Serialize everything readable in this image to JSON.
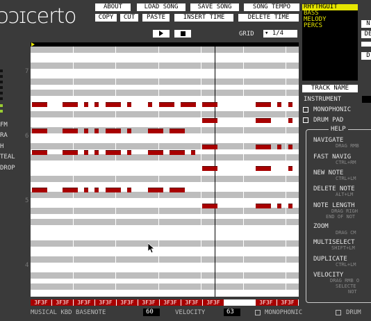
{
  "app": {
    "logo": "ɔɔɪcerto"
  },
  "toolbar": {
    "row1": [
      "ABOUT",
      "LOAD SONG",
      "SAVE SONG",
      "SONG TEMPO"
    ],
    "row2": [
      "COPY",
      "CUT",
      "PASTE",
      "INSERT TIME",
      "DELETE TIME"
    ]
  },
  "transport": {
    "play_icon": "play-icon",
    "stop_icon": "stop-icon"
  },
  "grid": {
    "label": "GRID",
    "value": "1/4"
  },
  "tracks": [
    {
      "name": "RHYTHGUIT",
      "selected": true
    },
    {
      "name": "BASS",
      "selected": false
    },
    {
      "name": "MELODY",
      "selected": false
    },
    {
      "name": "PERCS",
      "selected": false
    }
  ],
  "right_edge": {
    "n": "N",
    "de": "DE",
    "d": "D"
  },
  "track_panel": {
    "track_name_btn": "TRACK NAME",
    "instrument_label": "INSTRUMENT",
    "monophonic_label": "MONOPHONIC",
    "drum_pad_label": "DRUM PAD"
  },
  "left_labels": [
    "FM",
    "RA",
    "H",
    "TEAL",
    "DROP"
  ],
  "octave_labels": [
    "7",
    "6",
    "5",
    "4"
  ],
  "help": {
    "title": "HELP",
    "items": [
      {
        "title": "NAVIGATE",
        "sub": "DRAG RMB"
      },
      {
        "title": "FAST NAVIG",
        "sub": "CTRL+RM"
      },
      {
        "title": "NEW NOTE",
        "sub": "CTRL+LM"
      },
      {
        "title": "DELETE NOTE",
        "sub": "ALT+LM"
      },
      {
        "title": "NOTE LENGTH",
        "sub": "DRAG RIGH",
        "sub2": "END OF NOT"
      },
      {
        "title": "ZOOM",
        "sub": "DRAG CM"
      },
      {
        "title": "MULTISELECT",
        "sub": "SHIFT+LM"
      },
      {
        "title": "DUPLICATE",
        "sub": "CTRL+LM"
      },
      {
        "title": "VELOCITY",
        "sub": "DRAG RMB O",
        "sub2": "SELECTE",
        "sub3": "NOT"
      }
    ]
  },
  "ruler": [
    "3F3F",
    "3F3F",
    "3F3F",
    "3F3F",
    "3F3F",
    "3F3F",
    "3F3F",
    "3F3F",
    "3F3F",
    "3F3F",
    "3F3F",
    "3F3F"
  ],
  "bottom": {
    "base_label": "MUSICAL KBD BASENOTE",
    "base_value": "60",
    "vel_label": "VELOCITY",
    "vel_value": "63",
    "mono_label": "MONOPHONIC",
    "drum_label": "DRUM"
  },
  "colors": {
    "note": "#a80000",
    "track_highlight": "#e6e600",
    "level_meter": "#9acd32"
  }
}
